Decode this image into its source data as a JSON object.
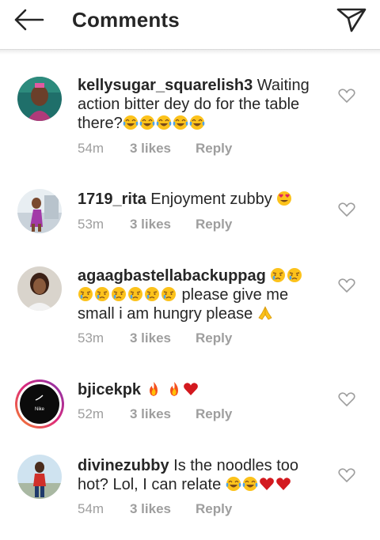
{
  "header": {
    "title": "Comments",
    "back_icon": "back-arrow-icon",
    "send_icon": "paper-plane-icon"
  },
  "comments": [
    {
      "username": "kellysugar_squarelish3",
      "text": " Waiting action bitter dey do for the table there?",
      "emojis": [
        "tears-of-joy",
        "tears-of-joy",
        "tears-of-joy",
        "tears-of-joy",
        "tears-of-joy"
      ],
      "time": "54m",
      "likes": "3 likes",
      "reply": "Reply"
    },
    {
      "username": "1719_rita",
      "text": " Enjoyment zubby ",
      "emojis": [
        "heart-eyes"
      ],
      "time": "53m",
      "likes": "3 likes",
      "reply": "Reply"
    },
    {
      "username": "agaagbastellabackuppag",
      "text": " please give me small i am hungry please ",
      "emojis_before": [
        "crying",
        "crying",
        "crying",
        "crying",
        "crying",
        "crying",
        "crying"
      ],
      "emojis": [
        "folded-hands"
      ],
      "time": "53m",
      "likes": "3 likes",
      "reply": "Reply"
    },
    {
      "username": "bjicekpk",
      "text": " ",
      "emojis": [
        "fire",
        "fire",
        "red-heart"
      ],
      "avatar_text": "Nike",
      "time": "52m",
      "likes": "3 likes",
      "reply": "Reply"
    },
    {
      "username": "divinezubby",
      "text": " Is the noodles too hot? Lol, I can relate ",
      "emojis": [
        "tears-of-joy",
        "tears-of-joy",
        "red-heart",
        "red-heart"
      ],
      "time": "54m",
      "likes": "3 likes",
      "reply": "Reply"
    }
  ],
  "colors": {
    "text": "#262626",
    "meta": "#9e9e9e",
    "story_ring": [
      "#f58529",
      "#dd2a7b",
      "#8134af"
    ]
  }
}
